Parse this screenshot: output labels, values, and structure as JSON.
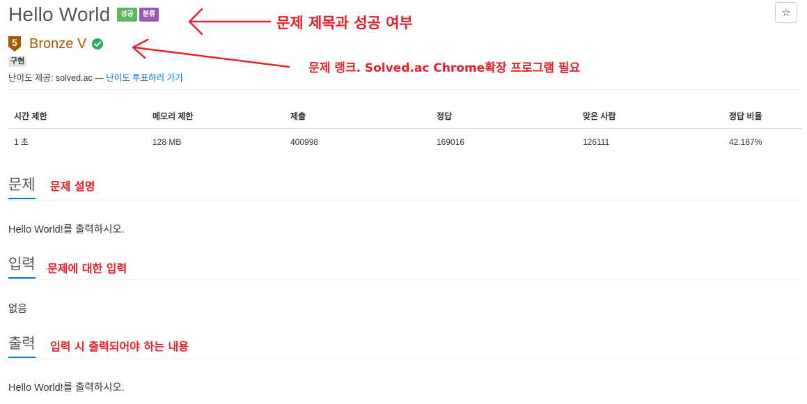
{
  "header": {
    "title": "Hello World",
    "badges": [
      "성공",
      "분류"
    ],
    "star": "☆"
  },
  "tier": {
    "number": "5",
    "name": "Bronze V",
    "tag": "구현",
    "difficulty_prefix": "난이도 제공: solved.ac — ",
    "difficulty_link": "난이도 투표하러 가기"
  },
  "stats": {
    "headers": [
      "시간 제한",
      "메모리 제한",
      "제출",
      "정답",
      "맞은 사람",
      "정답 비율"
    ],
    "values": [
      "1 초",
      "128 MB",
      "400998",
      "169016",
      "126111",
      "42.187%"
    ]
  },
  "sections": [
    {
      "title": "문제",
      "text": "Hello World!를 출력하시오."
    },
    {
      "title": "입력",
      "text": "없음"
    },
    {
      "title": "출력",
      "text": "Hello World!를 출력하시오."
    }
  ],
  "annotations": {
    "title_note": "문제 제목과 성공 여부",
    "rank_note": "문제 랭크. Solved.ac Chrome확장 프로그램 필요",
    "problem_note": "문제 설명",
    "input_note": "문제에 대한 입력",
    "output_note": "입력 시 출력되어야 하는 내용"
  },
  "colors": {
    "success": "#5cb85c",
    "class": "#9b59b6",
    "bronze": "#ad5600",
    "link": "#0076c0",
    "annotation": "#e8202a"
  }
}
